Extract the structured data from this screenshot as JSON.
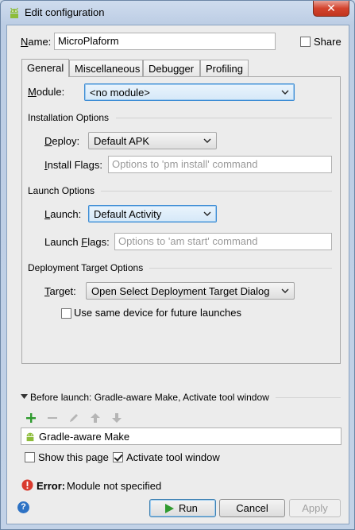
{
  "window": {
    "title": "Edit configuration",
    "close_glyph": "✕"
  },
  "name_field": {
    "label_mnemonic": "N",
    "label_rest": "ame:",
    "value": "MicroPlaform"
  },
  "share": {
    "label": "Share",
    "checked": false
  },
  "tabs": [
    {
      "label": "General",
      "active": true
    },
    {
      "label": "Miscellaneous",
      "active": false
    },
    {
      "label": "Debugger",
      "active": false
    },
    {
      "label": "Profiling",
      "active": false
    }
  ],
  "module": {
    "label_mnemonic": "M",
    "label_rest": "odule:",
    "value": "<no module>"
  },
  "installation": {
    "section_title": "Installation Options",
    "deploy_label_mnemonic": "D",
    "deploy_label_rest": "eploy:",
    "deploy_value": "Default APK",
    "flags_label_mnemonic": "I",
    "flags_label_rest": "nstall Flags:",
    "flags_placeholder": "Options to 'pm install' command"
  },
  "launch": {
    "section_title": "Launch Options",
    "launch_label_mnemonic": "L",
    "launch_label_rest": "aunch:",
    "launch_value": "Default Activity",
    "flags_label_pre": "Launch ",
    "flags_label_mnemonic": "F",
    "flags_label_rest": "lags:",
    "flags_placeholder": "Options to 'am start' command"
  },
  "deployment_target": {
    "section_title": "Deployment Target Options",
    "target_label_mnemonic": "T",
    "target_label_rest": "arget:",
    "target_value": "Open Select Deployment Target Dialog",
    "same_device_label": "Use same device for future launches",
    "same_device_checked": false
  },
  "before_launch": {
    "header": "Before launch: Gradle-aware Make, Activate tool window",
    "toolbar_icons": [
      "add-icon",
      "remove-icon",
      "edit-icon",
      "move-up-icon",
      "move-down-icon"
    ],
    "items": [
      {
        "label": "Gradle-aware Make",
        "icon": "android-icon"
      }
    ],
    "show_this_page_label": "Show this page",
    "show_this_page_checked": false,
    "activate_tool_window_label": "Activate tool window",
    "activate_tool_window_checked": true
  },
  "error": {
    "prefix": "Error:",
    "message": "Module not specified"
  },
  "buttons": {
    "help": "?",
    "run": "Run",
    "cancel": "Cancel",
    "apply": "Apply"
  },
  "colors": {
    "accent": "#3c8cd4",
    "error": "#d93a2e",
    "android_green": "#8dbd3a",
    "run_green": "#2f9a2f",
    "add_green": "#2f9a2f"
  }
}
